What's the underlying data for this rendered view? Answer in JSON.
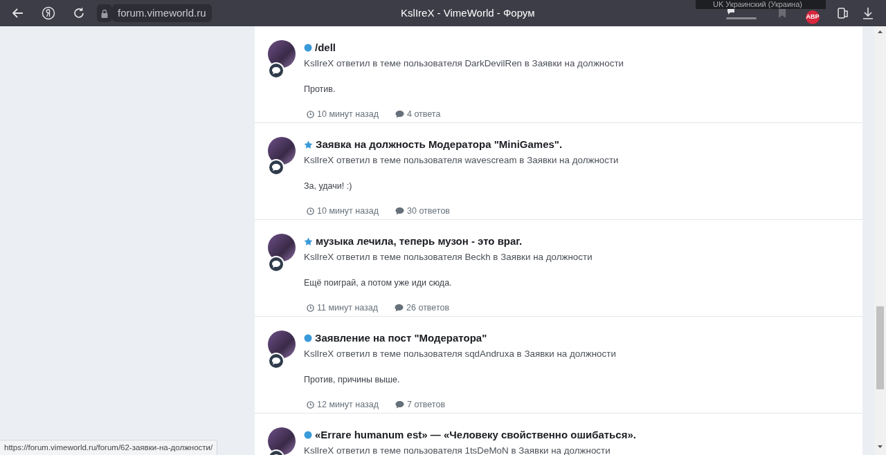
{
  "browser": {
    "address": "forum.vimeworld.ru",
    "title": "KslIreX - VimeWorld - Форум",
    "language_tooltip": "UK Украинский (Украина)",
    "adblock_badge": "ABP"
  },
  "activity": [
    {
      "kind": "dot",
      "title": "/dell",
      "meta": "KslIreX ответил в теме пользователя DarkDevilRen в Заявки на должности",
      "text": "Против.",
      "time": "10 минут назад",
      "replies": "4 ответа"
    },
    {
      "kind": "star",
      "title": "Заявка на должность Модератора \"MiniGames\".",
      "meta": "KslIreX ответил в теме пользователя wavescream в Заявки на должности",
      "text": "За, удачи! :)",
      "time": "10 минут назад",
      "replies": "30 ответов"
    },
    {
      "kind": "star",
      "title": "музыка лечила, теперь музон - это враг.",
      "meta": "KslIreX ответил в теме пользователя Beckh в Заявки на должности",
      "text": "Ещё поиграй, а потом уже иди сюда.",
      "time": "11 минут назад",
      "replies": "26 ответов"
    },
    {
      "kind": "dot",
      "title": "Заявление на пост \"Модератора\"",
      "meta": "KslIreX ответил в теме пользователя sqdAndruxa в Заявки на должности",
      "text": "Против, причины выше.",
      "time": "12 минут назад",
      "replies": "7 ответов"
    },
    {
      "kind": "dot",
      "title": "«Errare humanum est» — «Человеку свойственно ошибаться».",
      "meta": "KslIreX ответил в теме пользователя 1tsDeMoN в Заявки на должности"
    }
  ],
  "status_url": "https://forum.vimeworld.ru/forum/62-заявки-на-должности/"
}
